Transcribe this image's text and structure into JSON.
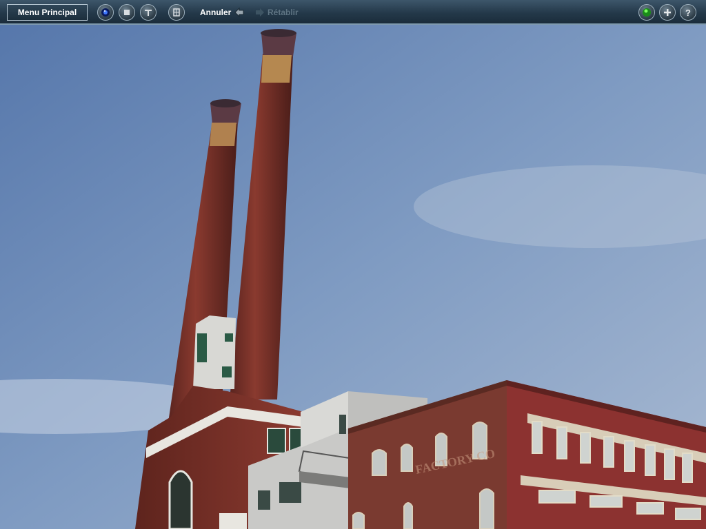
{
  "toolbar": {
    "menu_label": "Menu Principal",
    "undo_label": "Annuler",
    "redo_label": "Rétablir",
    "left_icons": [
      "camera-icon",
      "stop-icon",
      "tools-icon",
      "grid-icon"
    ],
    "right_icons": [
      "green-light-icon",
      "plus-icon",
      "help-icon"
    ]
  },
  "scene": {
    "sign_text": "FACTORY CO",
    "colors": {
      "sky_top": "#5f83b5",
      "sky_bottom": "#aec1d8",
      "brick": "#7a2e27"
    }
  }
}
